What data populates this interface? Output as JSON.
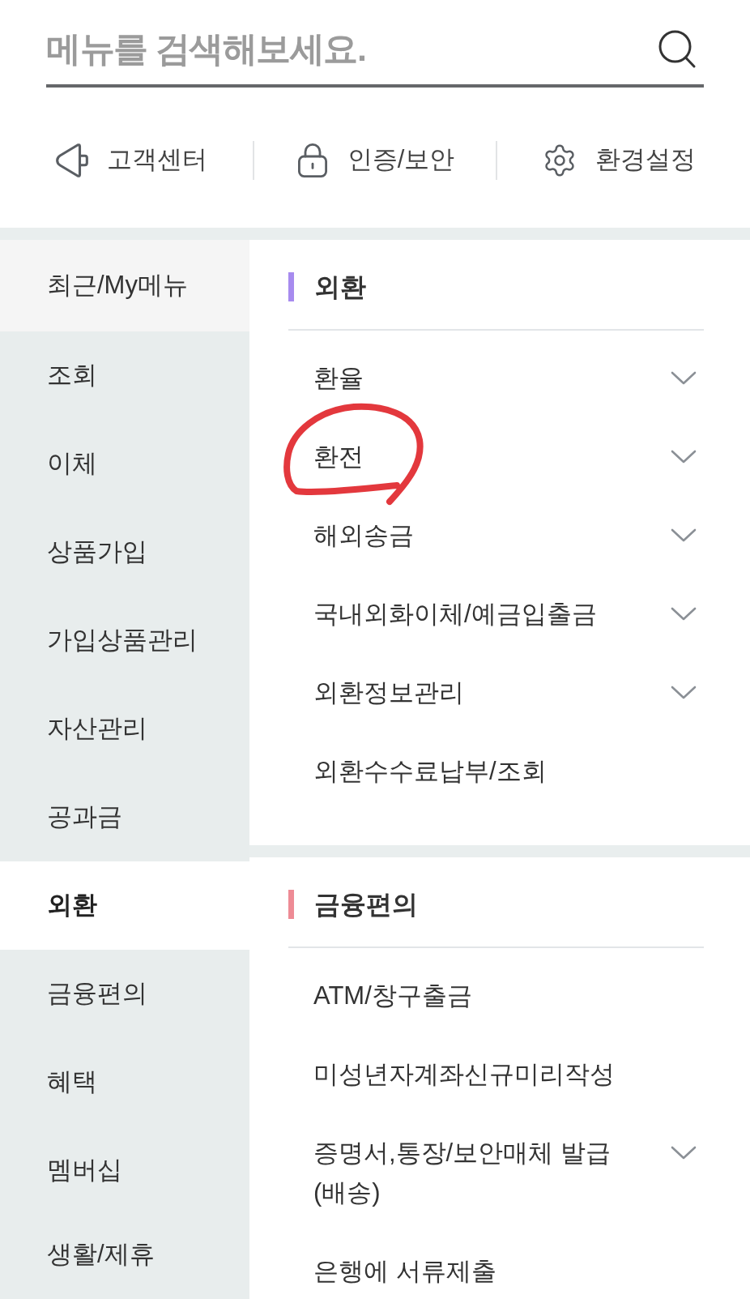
{
  "search": {
    "placeholder": "메뉴를 검색해보세요."
  },
  "quick_links": [
    {
      "kind": "support",
      "label": "고객센터"
    },
    {
      "kind": "security",
      "label": "인증/보안"
    },
    {
      "kind": "settings",
      "label": "환경설정"
    }
  ],
  "sidebar": {
    "pinned": {
      "label": "최근/My메뉴"
    },
    "items": [
      {
        "label": "조회",
        "selected": false
      },
      {
        "label": "이체",
        "selected": false
      },
      {
        "label": "상품가입",
        "selected": false
      },
      {
        "label": "가입상품관리",
        "selected": false
      },
      {
        "label": "자산관리",
        "selected": false
      },
      {
        "label": "공과금",
        "selected": false
      },
      {
        "label": "외환",
        "selected": true
      },
      {
        "label": "금융편의",
        "selected": false
      },
      {
        "label": "혜택",
        "selected": false
      },
      {
        "label": "멤버십",
        "selected": false
      },
      {
        "label": "생활/제휴",
        "selected": false
      }
    ]
  },
  "sections": [
    {
      "title": "외환",
      "color": "#a78bef",
      "items": [
        {
          "label": "환율",
          "has_submenu": true,
          "circled": false
        },
        {
          "label": "환전",
          "has_submenu": true,
          "circled": true
        },
        {
          "label": "해외송금",
          "has_submenu": true,
          "circled": false
        },
        {
          "label": "국내외화이체/예금입출금",
          "has_submenu": true,
          "circled": false
        },
        {
          "label": "외환정보관리",
          "has_submenu": true,
          "circled": false
        },
        {
          "label": "외환수수료납부/조회",
          "has_submenu": false,
          "circled": false
        }
      ]
    },
    {
      "title": "금융편의",
      "color": "#ee8b95",
      "items": [
        {
          "label": "ATM/창구출금",
          "has_submenu": false,
          "circled": false
        },
        {
          "label": "미성년자계좌신규미리작성",
          "has_submenu": false,
          "circled": false
        },
        {
          "label": "증명서,통장/보안매체 발급 (배송)",
          "has_submenu": true,
          "circled": false
        },
        {
          "label": "은행에 서류제출",
          "has_submenu": false,
          "circled": false
        }
      ]
    }
  ]
}
